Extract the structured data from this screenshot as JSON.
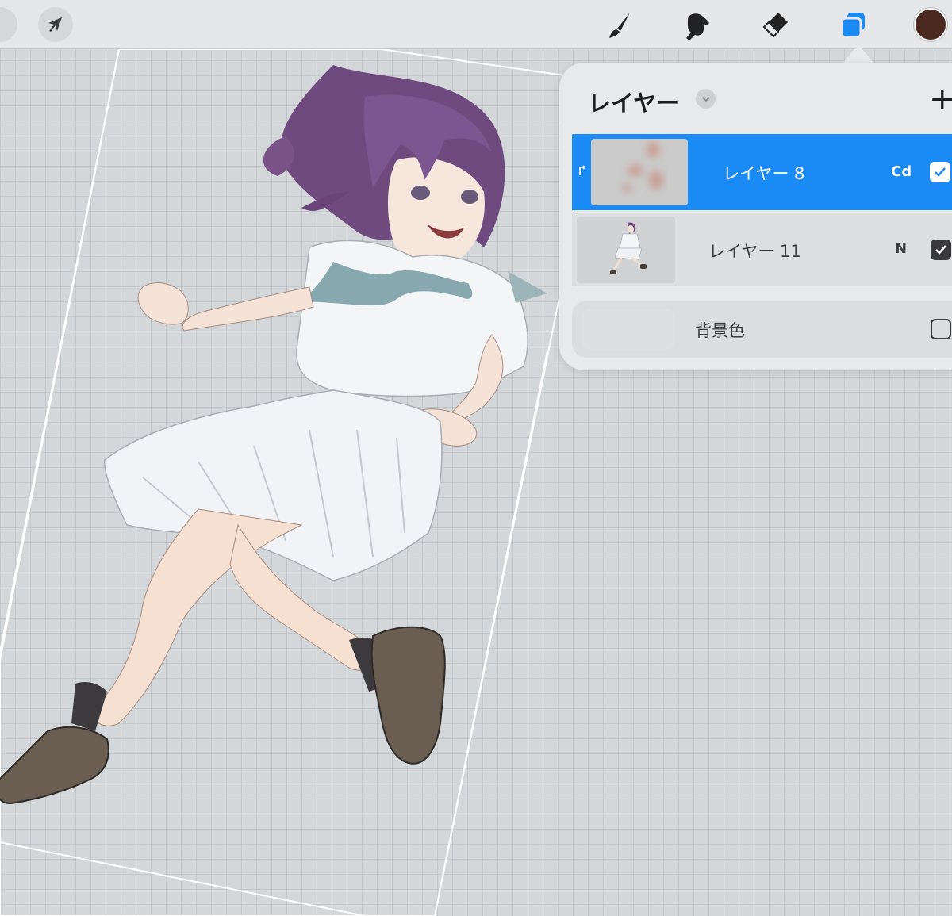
{
  "toolbar": {
    "tools": [
      {
        "name": "actions",
        "icon": "circle-button-icon"
      },
      {
        "name": "transform",
        "icon": "arrow-cursor-icon"
      },
      {
        "name": "brush",
        "icon": "brush-icon"
      },
      {
        "name": "smudge",
        "icon": "smudge-icon"
      },
      {
        "name": "eraser",
        "icon": "eraser-icon"
      },
      {
        "name": "layers",
        "icon": "layers-icon",
        "active": true
      },
      {
        "name": "color",
        "icon": "color-swatch",
        "color": "#4a2a20"
      }
    ]
  },
  "layers_panel": {
    "title": "レイヤー",
    "add_icon": "+",
    "layers": [
      {
        "name": "レイヤー 8",
        "blend": "Cd",
        "visible": true,
        "selected": true,
        "clipped": true
      },
      {
        "name": "レイヤー 11",
        "blend": "N",
        "visible": true,
        "selected": false
      }
    ],
    "background": {
      "name": "背景色",
      "visible": false
    }
  },
  "colors": {
    "accent": "#1a8af5",
    "canvas_bg": "#d4d7d9",
    "panel_bg": "#e8e9ea",
    "color_swatch": "#4a2a20"
  }
}
